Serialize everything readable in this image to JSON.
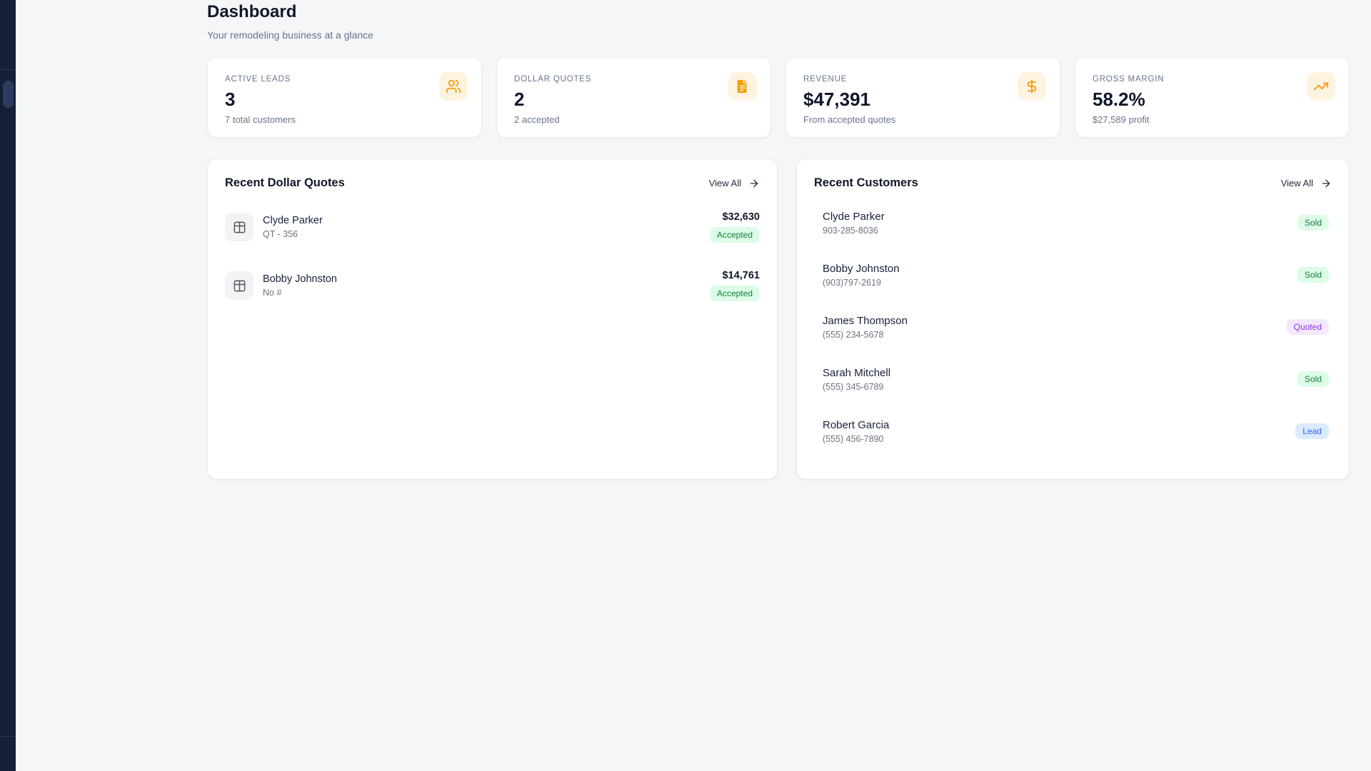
{
  "colors": {
    "page-bg": "#F5F6F8",
    "sidebar": "#152038",
    "accent-orange": "#F59E0B",
    "chip-bg": "#FDF3E1",
    "status-green-bg": "#DCFCE7",
    "status-green-text": "#15803D",
    "status-purple-bg": "#F3E8FF",
    "status-purple-text": "#9333EA",
    "status-blue-bg": "#DBEAFE",
    "status-blue-text": "#2563EB"
  },
  "page": {
    "title": "Dashboard",
    "subtitle": "Your remodeling business at a glance"
  },
  "stats": [
    {
      "label": "ACTIVE LEADS",
      "value": "3",
      "sub": "7 total customers",
      "icon": "users-icon"
    },
    {
      "label": "DOLLAR QUOTES",
      "value": "2",
      "sub": "2 accepted",
      "icon": "file-text-icon"
    },
    {
      "label": "REVENUE",
      "value": "$47,391",
      "sub": "From accepted quotes",
      "icon": "dollar-icon"
    },
    {
      "label": "GROSS MARGIN",
      "value": "58.2%",
      "sub": "$27,589 profit",
      "icon": "trending-up-icon"
    }
  ],
  "quotes_panel": {
    "title": "Recent Dollar Quotes",
    "view_all": "View All",
    "row_icon": "table-icon",
    "rows": [
      {
        "name": "Clyde Parker",
        "ref": "QT - 356",
        "amount": "$32,630",
        "status": "Accepted"
      },
      {
        "name": "Bobby Johnston",
        "ref": "No #",
        "amount": "$14,761",
        "status": "Accepted"
      }
    ]
  },
  "customers_panel": {
    "title": "Recent Customers",
    "view_all": "View All",
    "rows": [
      {
        "name": "Clyde Parker",
        "phone": "903-285-8036",
        "status": "Sold"
      },
      {
        "name": "Bobby Johnston",
        "phone": "(903)797-2619",
        "status": "Sold"
      },
      {
        "name": "James Thompson",
        "phone": "(555) 234-5678",
        "status": "Quoted"
      },
      {
        "name": "Sarah Mitchell",
        "phone": "(555) 345-6789",
        "status": "Sold"
      },
      {
        "name": "Robert Garcia",
        "phone": "(555) 456-7890",
        "status": "Lead"
      }
    ]
  }
}
